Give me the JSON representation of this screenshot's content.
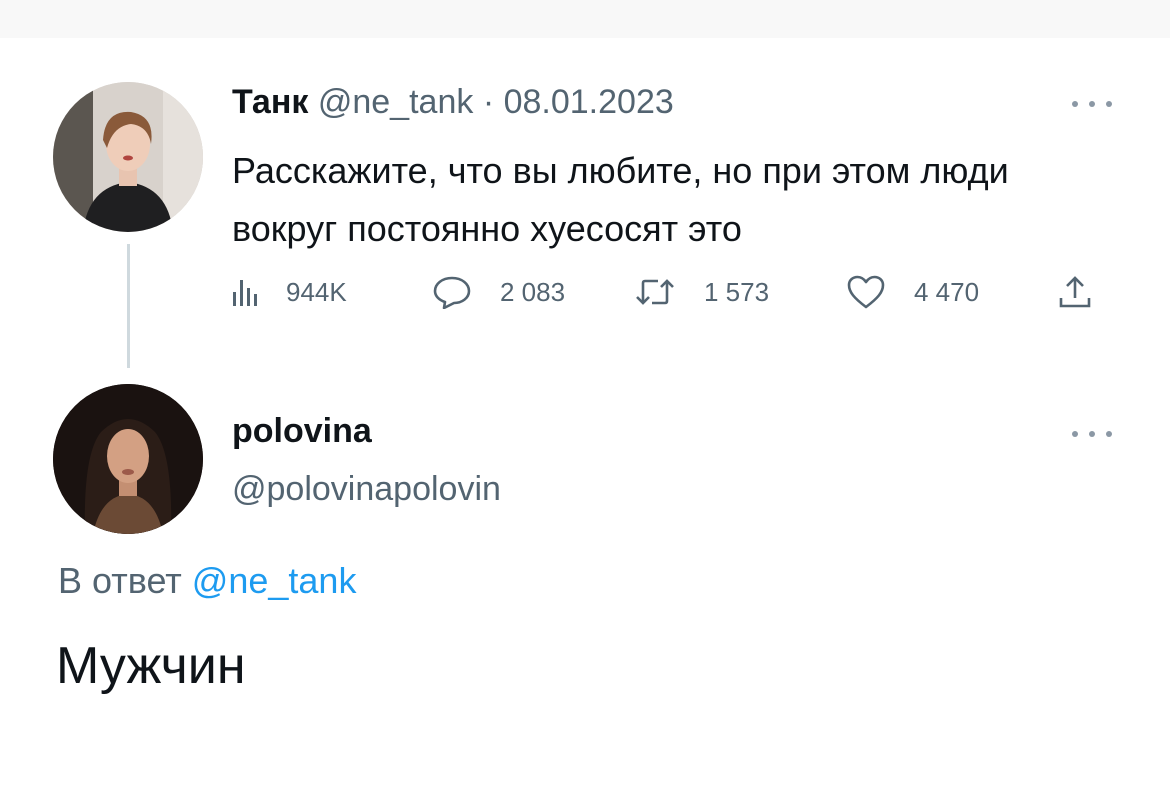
{
  "tweet": {
    "author_name": "Танк",
    "author_handle": "@ne_tank",
    "separator": "·",
    "date": "08.01.2023",
    "text": "Расскажите, что вы любите, но при этом люди вокруг постоянно хуесосят это",
    "stats": {
      "views": "944K",
      "replies": "2 083",
      "retweets": "1 573",
      "likes": "4 470"
    }
  },
  "reply": {
    "author_name": "polovina",
    "author_handle": "@polovinapolovin",
    "reply_prefix": "В ответ",
    "reply_mention": "@ne_tank",
    "text": "Мужчин"
  },
  "colors": {
    "text_primary": "#0f1419",
    "text_secondary": "#536471",
    "link": "#1d9bf0",
    "thread_line": "#cfd9de"
  },
  "icons": [
    "views-icon",
    "reply-icon",
    "retweet-icon",
    "like-icon",
    "share-icon",
    "more-icon"
  ]
}
